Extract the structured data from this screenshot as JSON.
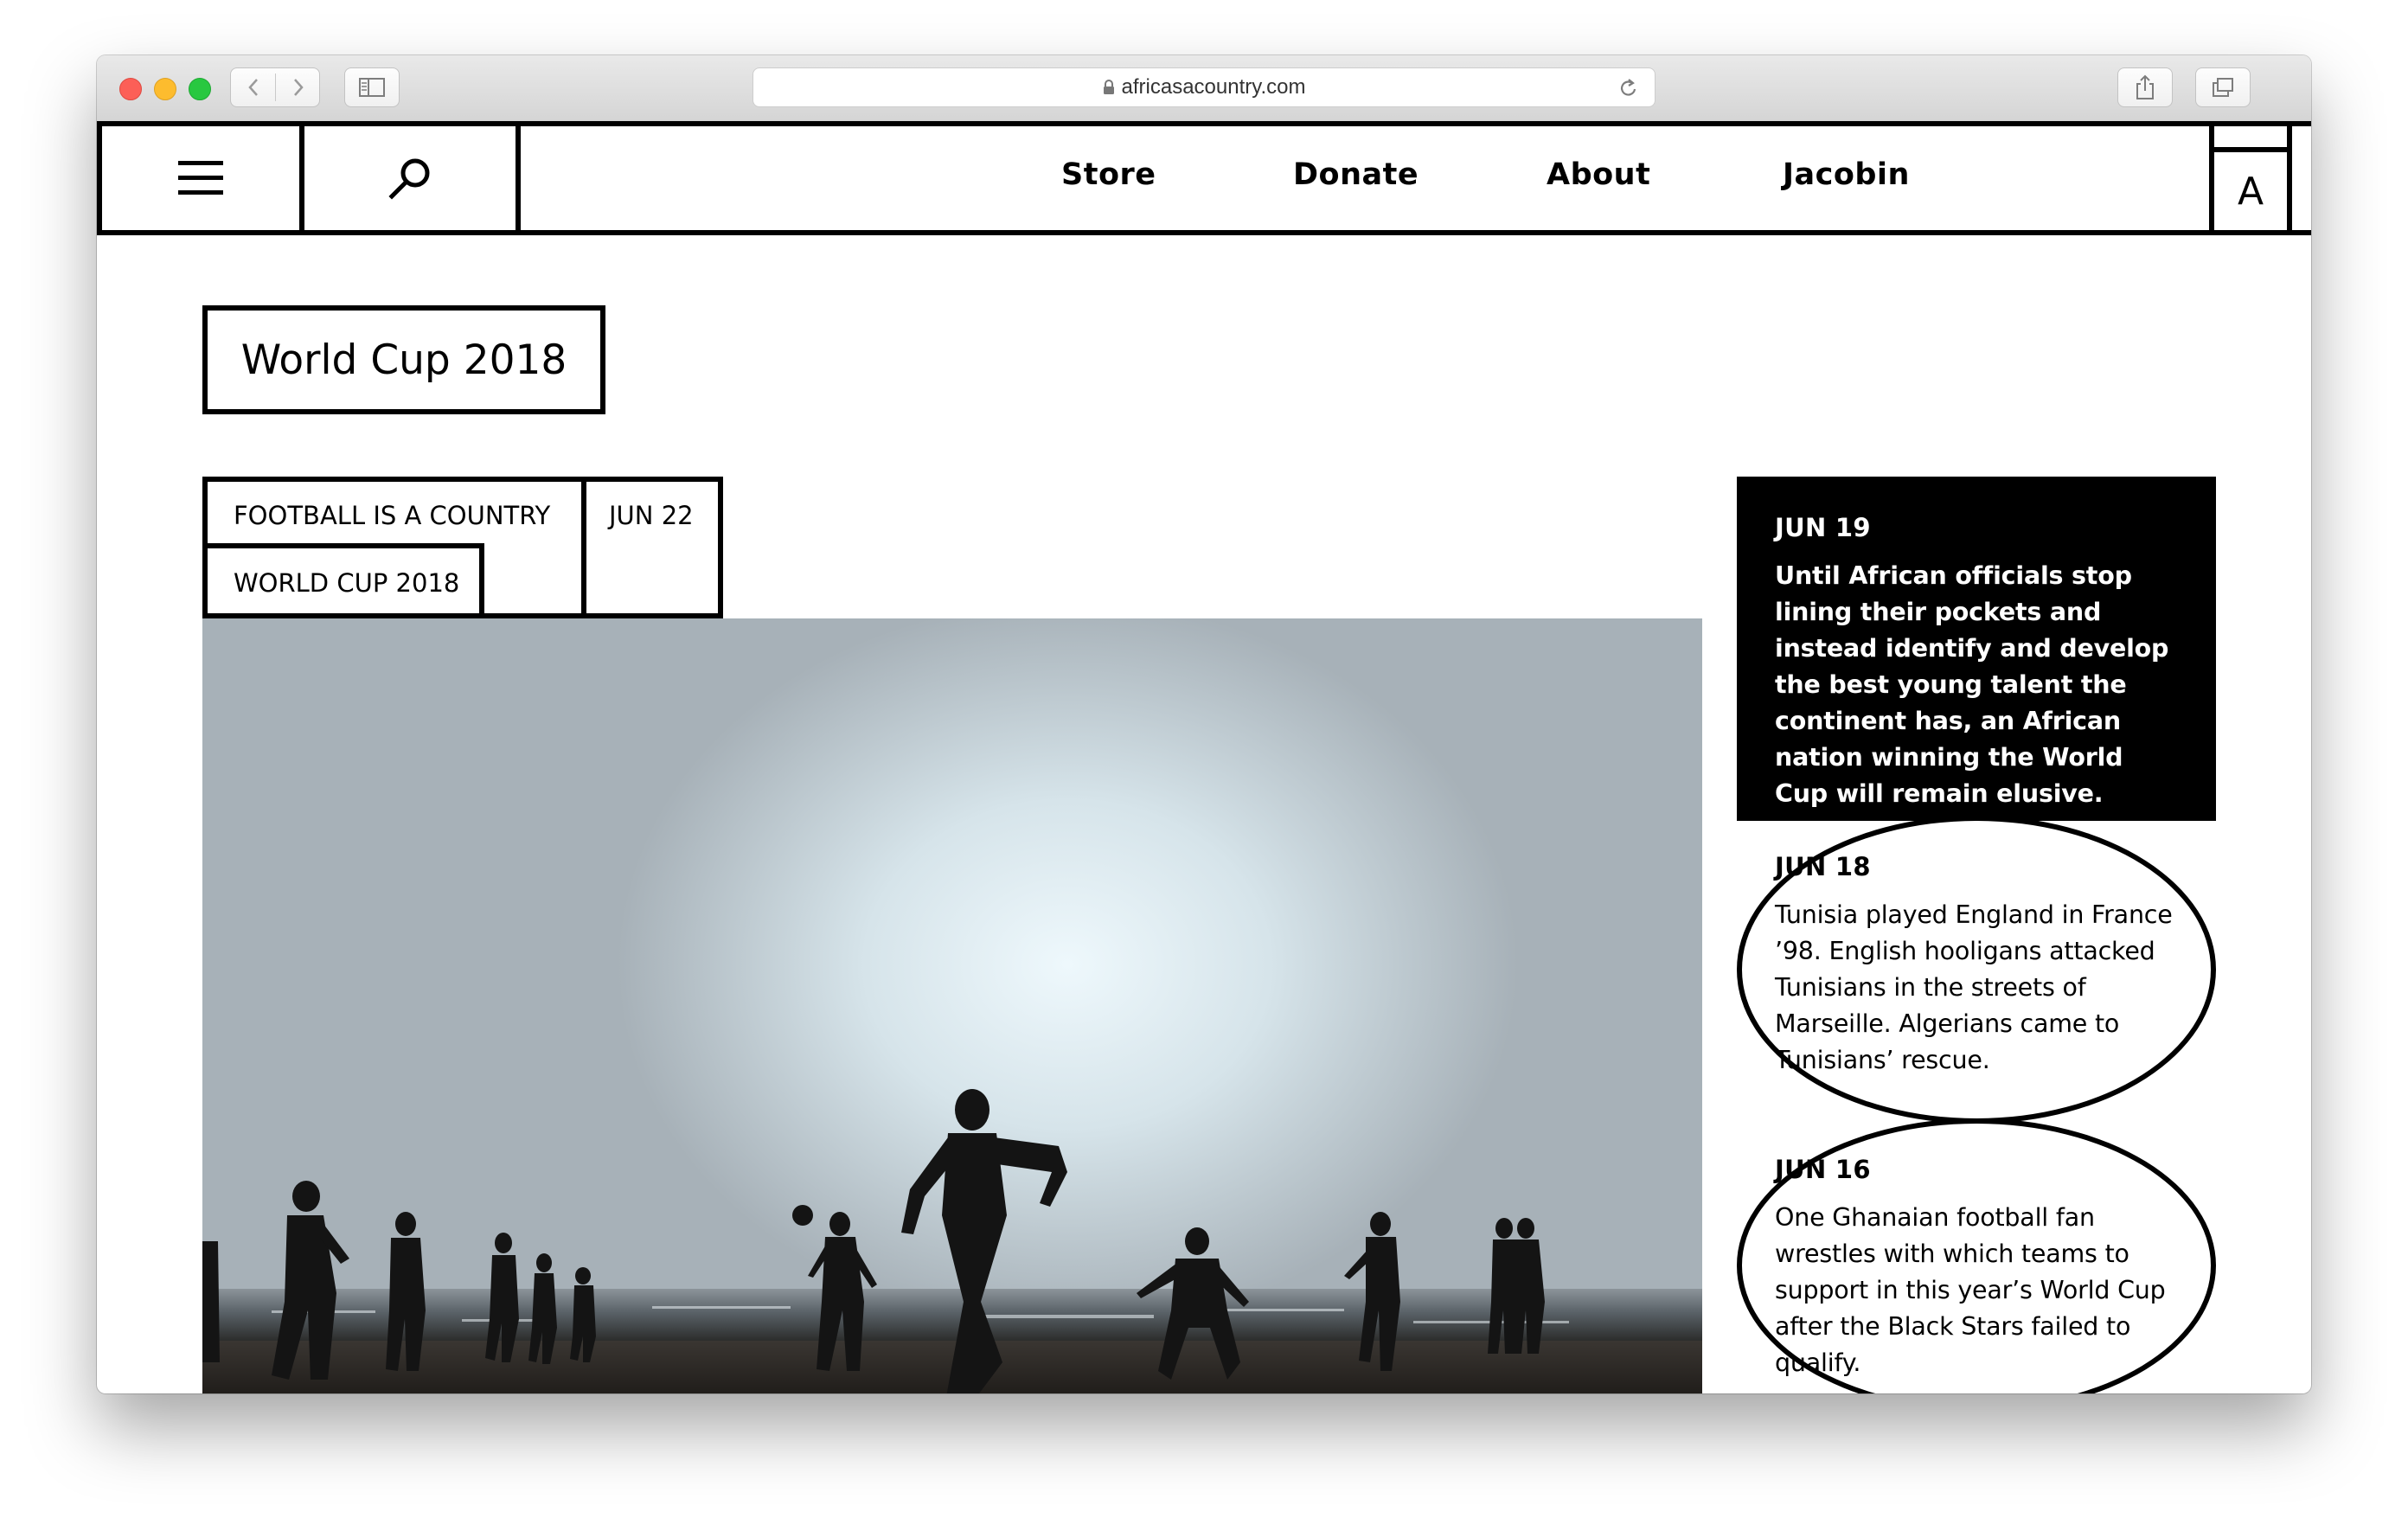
{
  "browser": {
    "url": "africasacountry.com"
  },
  "header": {
    "nav": [
      {
        "label": "Store"
      },
      {
        "label": "Donate"
      },
      {
        "label": "About"
      },
      {
        "label": "Jacobin"
      }
    ],
    "logo": "A"
  },
  "category": {
    "title": "World Cup 2018"
  },
  "feature": {
    "tags": [
      "FOOTBALL IS A COUNTRY",
      "WORLD CUP 2018"
    ],
    "date": "JUN 22",
    "image": "silhouettes of people playing football on a beach at sunset"
  },
  "sidebar": {
    "cards": [
      {
        "date": "JUN 19",
        "text": "Until African officials stop lining their pockets and instead identify and develop the best young talent the continent has, an African nation winning the World Cup will remain elusive."
      },
      {
        "date": "JUN 18",
        "text": "Tunisia played England in France ’98. English hooligans attacked Tunisians in the streets of Marseille. Algerians came to Tunisians’ rescue."
      },
      {
        "date": "JUN 16",
        "text": "One Ghanaian football fan wrestles with which teams to support in this year’s World Cup after the Black Stars failed to qualify."
      }
    ]
  },
  "colors": {
    "accent": "#000000",
    "background": "#ffffff"
  }
}
